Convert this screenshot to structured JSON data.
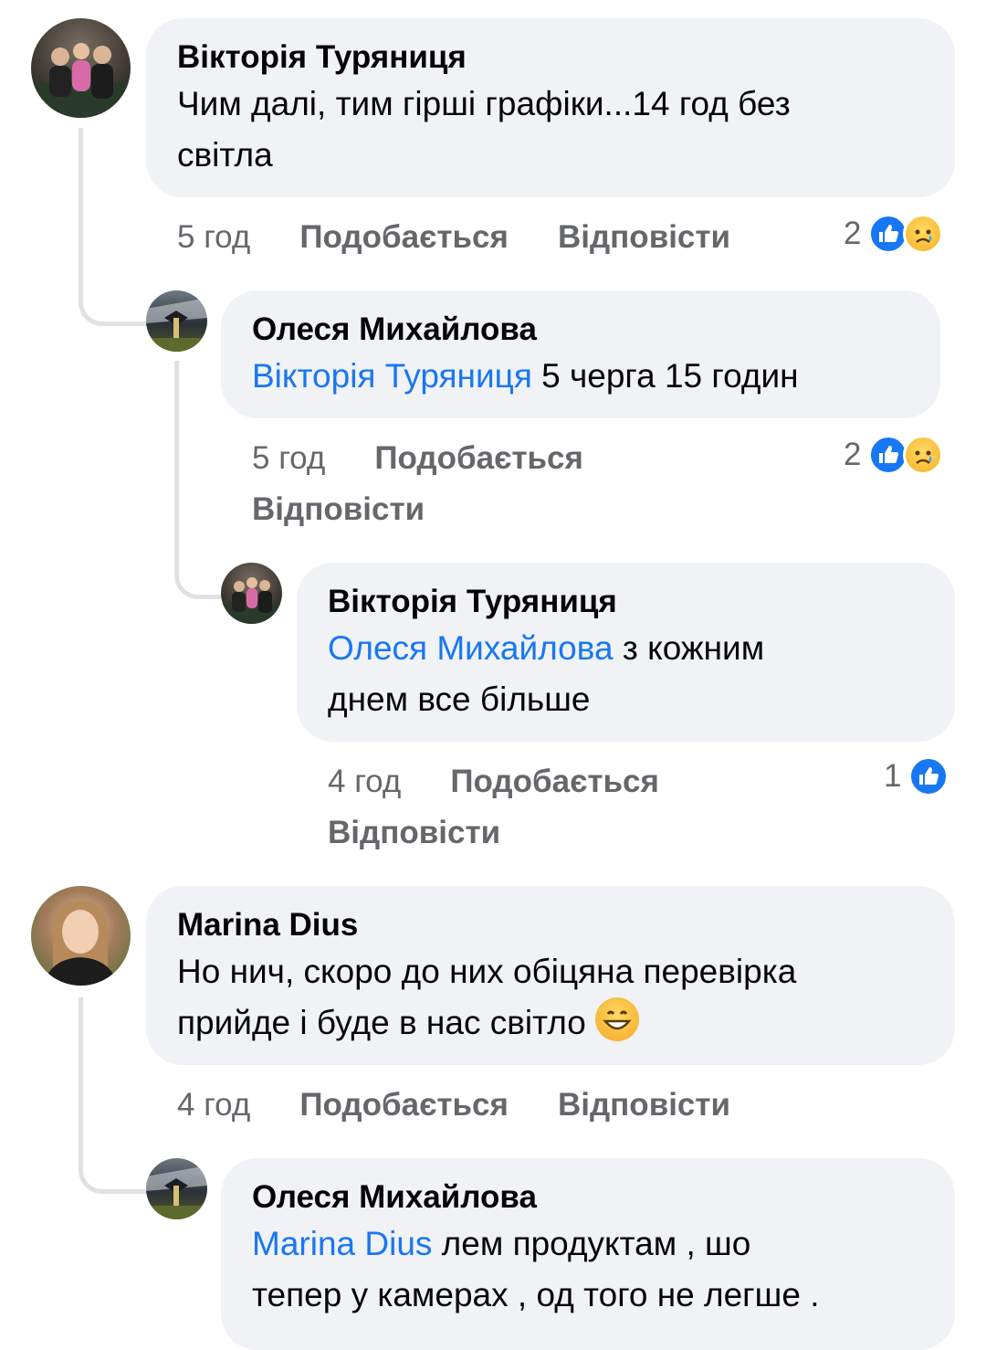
{
  "comments": [
    {
      "author": "Вікторія Туряниця",
      "text_line1": "Чим далі, тим гірші графіки...14 год без",
      "text_line2": "світла",
      "time": "5 год",
      "like": "Подобається",
      "reply": "Відповісти",
      "reaction_count": "2"
    },
    {
      "author": "Олеся Михайлова",
      "mention": "Вікторія Туряниця",
      "text": " 5 черга 15 годин",
      "time": "5 год",
      "like": "Подобається",
      "reply": "Відповісти",
      "reaction_count": "2"
    },
    {
      "author": "Вікторія Туряниця",
      "mention": "Олеся Михайлова",
      "text_line1": " з кожним",
      "text_line2": "днем все більше",
      "time": "4 год",
      "like": "Подобається",
      "reply": "Відповісти",
      "reaction_count": "1"
    },
    {
      "author": "Marina Dius",
      "text_line1": "Но нич, скоро до них обіцяна перевірка",
      "text_line2": "прийде і буде в нас світло",
      "time": "4 год",
      "like": "Подобається",
      "reply": "Відповісти"
    },
    {
      "author": "Олеся Михайлова",
      "mention": "Marina Dius",
      "text_line1": " лем продуктам , шо",
      "text_line2": "тепер у камерах , од того не легше ."
    }
  ],
  "icons": {
    "like": "like-reaction-icon",
    "sad": "sad-reaction-icon",
    "grin": "grinning-emoji-icon"
  },
  "colors": {
    "mention": "#1877f2",
    "bubble": "#f0f2f5",
    "meta": "#65676b",
    "thread_line": "#dfe1e5"
  }
}
